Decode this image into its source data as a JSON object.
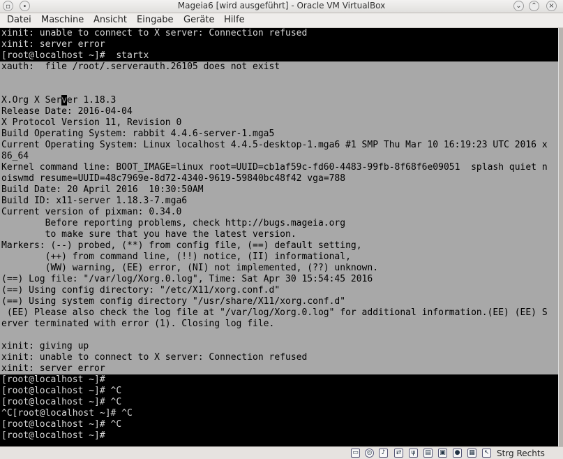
{
  "window": {
    "title": "Mageia6 [wird ausgeführt] - Oracle VM VirtualBox",
    "left_icons": [
      "app-icon",
      "pin-icon"
    ],
    "controls": [
      "minimize-icon",
      "maximize-icon",
      "close-icon"
    ]
  },
  "menu": [
    "Datei",
    "Maschine",
    "Ansicht",
    "Eingabe",
    "Geräte",
    "Hilfe"
  ],
  "terminal": {
    "colors": {
      "dark_bg": "#000000",
      "light_bg": "#a8a8a8",
      "dark_fg": "#d8d8d8",
      "light_fg": "#000000"
    },
    "lines": [
      {
        "text": "xinit: unable to connect to X server: Connection refused",
        "bg": "dark"
      },
      {
        "text": "xinit: server error",
        "bg": "dark"
      },
      {
        "text": "[root@localhost ~]#  startx",
        "bg": "dark"
      },
      {
        "text": "xauth:  file /root/.serverauth.26105 does not exist",
        "bg": "light"
      },
      {
        "text": "",
        "bg": "light"
      },
      {
        "text": "",
        "bg": "light"
      },
      {
        "text": "X.Org X Server 1.18.3",
        "bg": "light"
      },
      {
        "text": "Release Date: 2016-04-04",
        "bg": "light"
      },
      {
        "text": "X Protocol Version 11, Revision 0",
        "bg": "light"
      },
      {
        "text": "Build Operating System: rabbit 4.4.6-server-1.mga5",
        "bg": "light"
      },
      {
        "text": "Current Operating System: Linux localhost 4.4.5-desktop-1.mga6 #1 SMP Thu Mar 10 16:19:23 UTC 2016 x",
        "bg": "light"
      },
      {
        "text": "86_64",
        "bg": "light"
      },
      {
        "text": "Kernel command line: BOOT_IMAGE=linux root=UUID=cb1af59c-fd60-4483-99fb-8f68f6e09051  splash quiet n",
        "bg": "light"
      },
      {
        "text": "oiswmd resume=UUID=48c7969e-8d72-4340-9619-59840bc48f42 vga=788",
        "bg": "light"
      },
      {
        "text": "Build Date: 20 April 2016  10:30:50AM",
        "bg": "light"
      },
      {
        "text": "Build ID: x11-server 1.18.3-7.mga6",
        "bg": "light"
      },
      {
        "text": "Current version of pixman: 0.34.0",
        "bg": "light"
      },
      {
        "text": "        Before reporting problems, check http://bugs.mageia.org",
        "bg": "light"
      },
      {
        "text": "        to make sure that you have the latest version.",
        "bg": "light"
      },
      {
        "text": "Markers: (--) probed, (**) from config file, (==) default setting,",
        "bg": "light"
      },
      {
        "text": "        (++) from command line, (!!) notice, (II) informational,",
        "bg": "light"
      },
      {
        "text": "        (WW) warning, (EE) error, (NI) not implemented, (??) unknown.",
        "bg": "light"
      },
      {
        "text": "(==) Log file: \"/var/log/Xorg.0.log\", Time: Sat Apr 30 15:54:45 2016",
        "bg": "light"
      },
      {
        "text": "(==) Using config directory: \"/etc/X11/xorg.conf.d\"",
        "bg": "light"
      },
      {
        "text": "(==) Using system config directory \"/usr/share/X11/xorg.conf.d\"",
        "bg": "light"
      },
      {
        "text": " (EE) Please also check the log file at \"/var/log/Xorg.0.log\" for additional information.(EE) (EE) S",
        "bg": "light"
      },
      {
        "text": "erver terminated with error (1). Closing log file.",
        "bg": "light"
      },
      {
        "text": "",
        "bg": "light"
      },
      {
        "text": "xinit: giving up",
        "bg": "light"
      },
      {
        "text": "xinit: unable to connect to X server: Connection refused",
        "bg": "light"
      },
      {
        "text": "xinit: server error",
        "bg": "light"
      },
      {
        "text": "[root@localhost ~]#",
        "bg": "dark"
      },
      {
        "text": "[root@localhost ~]# ^C",
        "bg": "dark"
      },
      {
        "text": "[root@localhost ~]# ^C",
        "bg": "dark"
      },
      {
        "text": "^C[root@localhost ~]# ^C",
        "bg": "dark"
      },
      {
        "text": "[root@localhost ~]# ^C",
        "bg": "dark"
      },
      {
        "text": "[root@localhost ~]#",
        "bg": "dark"
      }
    ],
    "cursor": {
      "line": 6,
      "char": 11
    }
  },
  "status_bar": {
    "icons": [
      "hard-disk-icon",
      "optical-drive-icon",
      "audio-icon",
      "network-icon",
      "usb-icon",
      "shared-folder-icon",
      "display-icon",
      "video-capture-icon",
      "cpu-icon",
      "mouse-integration-icon",
      "keyboard-icon"
    ],
    "host_key": "Strg Rechts"
  }
}
